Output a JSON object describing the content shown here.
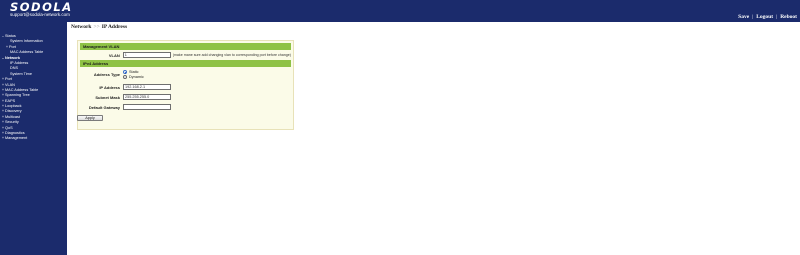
{
  "brand": {
    "logo": "SODOLA",
    "support": "support@sodola-network.com"
  },
  "header_actions": {
    "save": "Save",
    "logout": "Logout",
    "reboot": "Reboot",
    "separator": "|"
  },
  "breadcrumb": {
    "section": "Network",
    "separator": ">>",
    "page": "IP Address"
  },
  "sidebar": {
    "items": [
      {
        "level": 1,
        "label": "Status",
        "bullet": "–",
        "bold": false
      },
      {
        "level": 3,
        "label": "System Information",
        "bullet": "",
        "bold": false
      },
      {
        "level": 2,
        "label": "Port",
        "bullet": "+",
        "bold": false
      },
      {
        "level": 3,
        "label": "MAC Address Table",
        "bullet": "",
        "bold": false
      },
      {
        "level": 1,
        "label": "Network",
        "bullet": "–",
        "bold": true
      },
      {
        "level": 3,
        "label": "IP Address",
        "bullet": "",
        "bold": false
      },
      {
        "level": 3,
        "label": "DNS",
        "bullet": "",
        "bold": false
      },
      {
        "level": 3,
        "label": "System Time",
        "bullet": "",
        "bold": false
      },
      {
        "level": 1,
        "label": "Port",
        "bullet": "+",
        "bold": false
      },
      {
        "level": 1,
        "label": "VLAN",
        "bullet": "+",
        "bold": false
      },
      {
        "level": 1,
        "label": "MAC Address Table",
        "bullet": "+",
        "bold": false
      },
      {
        "level": 1,
        "label": "Spanning Tree",
        "bullet": "+",
        "bold": false
      },
      {
        "level": 1,
        "label": "EAPS",
        "bullet": "+",
        "bold": false
      },
      {
        "level": 1,
        "label": "Loopback",
        "bullet": "+",
        "bold": false
      },
      {
        "level": 1,
        "label": "Discovery",
        "bullet": "+",
        "bold": false
      },
      {
        "level": 1,
        "label": "Multicast",
        "bullet": "+",
        "bold": false
      },
      {
        "level": 1,
        "label": "Security",
        "bullet": "+",
        "bold": false
      },
      {
        "level": 1,
        "label": "QoS",
        "bullet": "+",
        "bold": false
      },
      {
        "level": 1,
        "label": "Diagnostics",
        "bullet": "+",
        "bold": false
      },
      {
        "level": 1,
        "label": "Management",
        "bullet": "+",
        "bold": false
      }
    ]
  },
  "form": {
    "mgmt_vlan_header": "Management VLAN",
    "vlan_label": "VLAN",
    "vlan_value": "1",
    "vlan_hint": "(make mane sure add changing vlan to corresponding port before change)",
    "ipv4_header": "IPv4 Address",
    "address_type_label": "Address Type",
    "address_type_options": [
      "Static",
      "Dynamic"
    ],
    "address_type_selected": "Static",
    "ip_label": "IP Address",
    "ip_value": "192.168.2.1",
    "mask_label": "Subnet Mask",
    "mask_value": "255.255.255.0",
    "gateway_label": "Default Gateway",
    "gateway_value": "",
    "apply_label": "Apply"
  },
  "colors": {
    "navy": "#1b2b6c",
    "section_green": "#8fc246",
    "panel_bg": "#fbfbe8"
  }
}
